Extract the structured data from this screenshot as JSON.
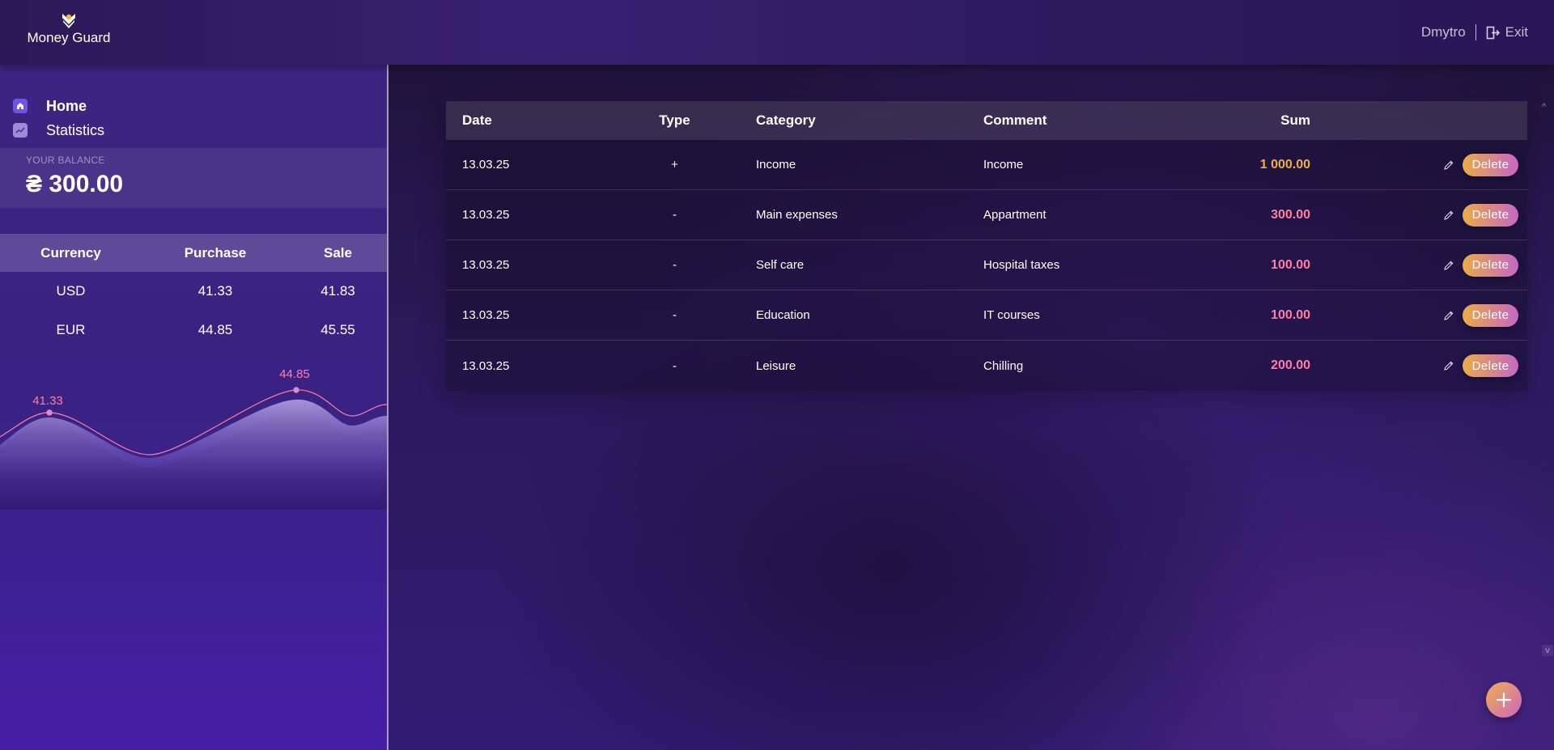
{
  "app": {
    "title": "Money Guard"
  },
  "header": {
    "username": "Dmytro",
    "exit_label": "Exit"
  },
  "nav": {
    "items": [
      {
        "label": "Home",
        "icon": "home-icon",
        "active": true
      },
      {
        "label": "Statistics",
        "icon": "chart-icon",
        "active": false
      }
    ]
  },
  "balance": {
    "label": "YOUR BALANCE",
    "value": "₴ 300.00"
  },
  "currency": {
    "headers": {
      "currency": "Currency",
      "purchase": "Purchase",
      "sale": "Sale"
    },
    "rows": [
      {
        "currency": "USD",
        "purchase": "41.33",
        "sale": "41.83"
      },
      {
        "currency": "EUR",
        "purchase": "44.85",
        "sale": "45.55"
      }
    ],
    "chart_labels": [
      "41.33",
      "44.85"
    ]
  },
  "transactions": {
    "headers": {
      "date": "Date",
      "type": "Type",
      "category": "Category",
      "comment": "Comment",
      "sum": "Sum"
    },
    "delete_label": "Delete",
    "rows": [
      {
        "date": "13.03.25",
        "type": "+",
        "category": "Income",
        "comment": "Income",
        "sum": "1 000.00",
        "kind": "income"
      },
      {
        "date": "13.03.25",
        "type": "-",
        "category": "Main expenses",
        "comment": "Appartment",
        "sum": "300.00",
        "kind": "expense"
      },
      {
        "date": "13.03.25",
        "type": "-",
        "category": "Self care",
        "comment": "Hospital taxes",
        "sum": "100.00",
        "kind": "expense"
      },
      {
        "date": "13.03.25",
        "type": "-",
        "category": "Education",
        "comment": "IT courses",
        "sum": "100.00",
        "kind": "expense"
      },
      {
        "date": "13.03.25",
        "type": "-",
        "category": "Leisure",
        "comment": "Chilling",
        "sum": "200.00",
        "kind": "expense"
      }
    ]
  },
  "colors": {
    "income_sum": "#f0ac45",
    "expense_sum": "#ff7ea4",
    "chart_line": "#ff7ea4",
    "button_gradient_start": "#ebac44",
    "button_gradient_end": "#c566c6"
  }
}
